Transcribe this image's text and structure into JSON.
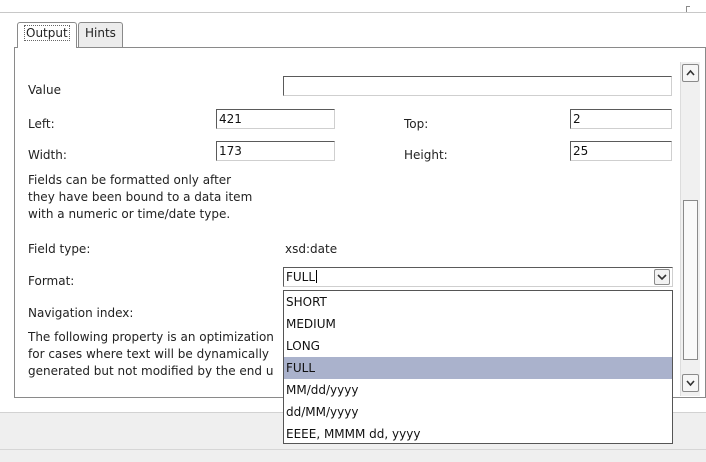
{
  "tabs": [
    {
      "label": "Output",
      "active": true
    },
    {
      "label": "Hints",
      "active": false
    }
  ],
  "form": {
    "value_label": "Value",
    "value_value": "",
    "left_label": "Left:",
    "left_value": "421",
    "top_label": "Top:",
    "top_value": "2",
    "width_label": "Width:",
    "width_value": "173",
    "height_label": "Height:",
    "height_value": "25",
    "format_note": [
      "Fields can be formatted only after",
      "they have been bound to a data item",
      "with a numeric  or time/date type."
    ],
    "field_type_label": "Field type:",
    "field_type_value": "xsd:date",
    "format_label": "Format:",
    "format_value": "FULL",
    "nav_index_label": "Navigation index:",
    "optimization_note": [
      "The following property is an optimization",
      "for cases where text will be dynamically",
      "generated but not modified by the end u"
    ]
  },
  "format_options": [
    "SHORT",
    "MEDIUM",
    "LONG",
    "FULL",
    "MM/dd/yyyy",
    "dd/MM/yyyy",
    "EEEE, MMMM dd, yyyy"
  ],
  "format_selected_index": 3,
  "icons": {
    "dropdown": "chevron-down-icon",
    "scroll_up": "arrow-up-icon",
    "scroll_down": "arrow-down-icon"
  },
  "colors": {
    "selection": "#aab2cc",
    "border": "#8a8a8a"
  }
}
